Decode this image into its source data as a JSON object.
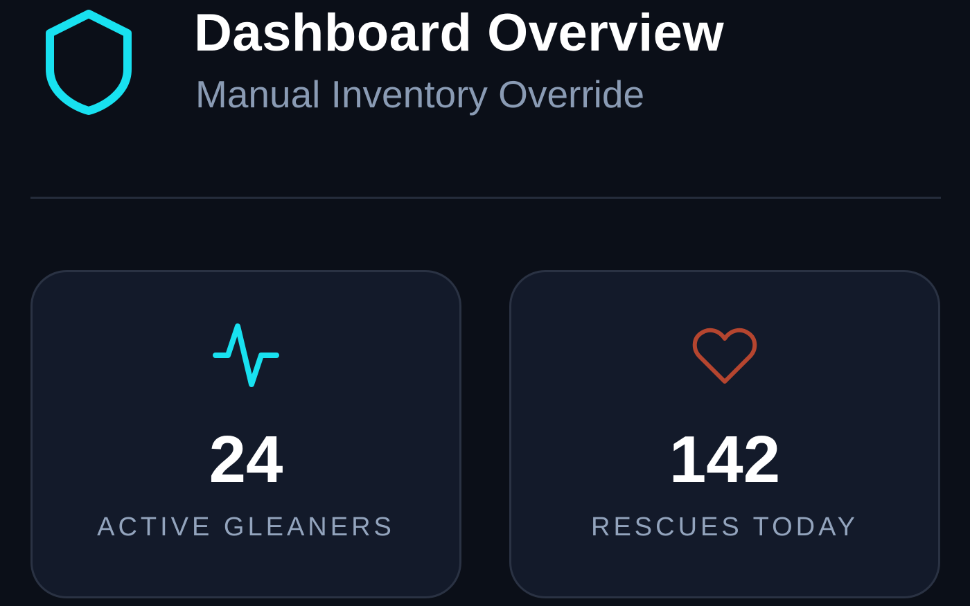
{
  "header": {
    "title": "Dashboard Overview",
    "subtitle": "Manual Inventory Override",
    "logo_icon": "shield-icon"
  },
  "stats": [
    {
      "value": "24",
      "label": "ACTIVE GLEANERS",
      "icon": "activity-pulse-icon",
      "icon_color": "#18e1f0"
    },
    {
      "value": "142",
      "label": "RESCUES TODAY",
      "icon": "heart-icon",
      "icon_color": "#b5452f"
    }
  ],
  "colors": {
    "background": "#0b0f18",
    "card_background": "#131a2a",
    "accent": "#18e1f0",
    "muted_text": "#8a9bb4"
  }
}
